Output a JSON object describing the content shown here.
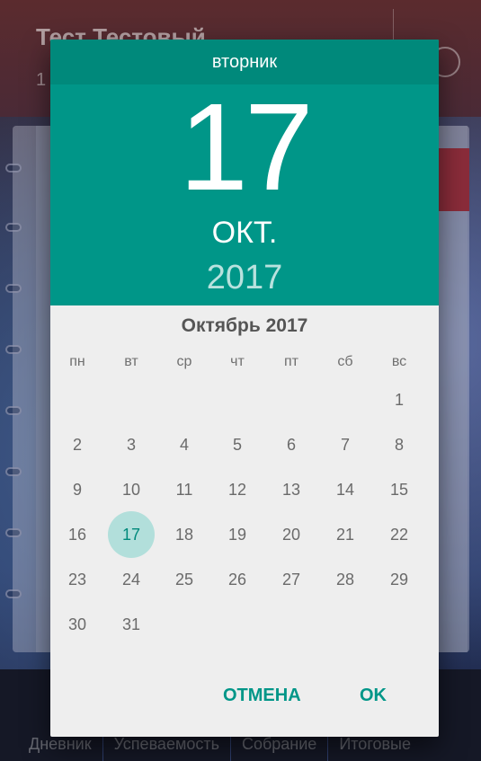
{
  "background": {
    "title": "Тест Тестовый",
    "subtitle": "1",
    "nav": [
      "Дневник",
      "Успеваемость",
      "Собрание",
      "Итоговые"
    ]
  },
  "dialog": {
    "weekday": "вторник",
    "day": "17",
    "month": "ОКТ.",
    "year": "2017",
    "calendar_title": "Октябрь 2017",
    "weekday_headers": [
      "пн",
      "вт",
      "ср",
      "чт",
      "пт",
      "сб",
      "вс"
    ],
    "days": [
      "1",
      "2",
      "3",
      "4",
      "5",
      "6",
      "7",
      "8",
      "9",
      "10",
      "11",
      "12",
      "13",
      "14",
      "15",
      "16",
      "17",
      "18",
      "19",
      "20",
      "21",
      "22",
      "23",
      "24",
      "25",
      "26",
      "27",
      "28",
      "29",
      "30",
      "31"
    ],
    "first_weekday_index": 6,
    "selected_day": "17",
    "cancel_label": "ОТМЕНА",
    "ok_label": "OK"
  },
  "colors": {
    "accent": "#009688",
    "header_dark": "#00897b",
    "selected_circle": "#b2dfdb"
  }
}
